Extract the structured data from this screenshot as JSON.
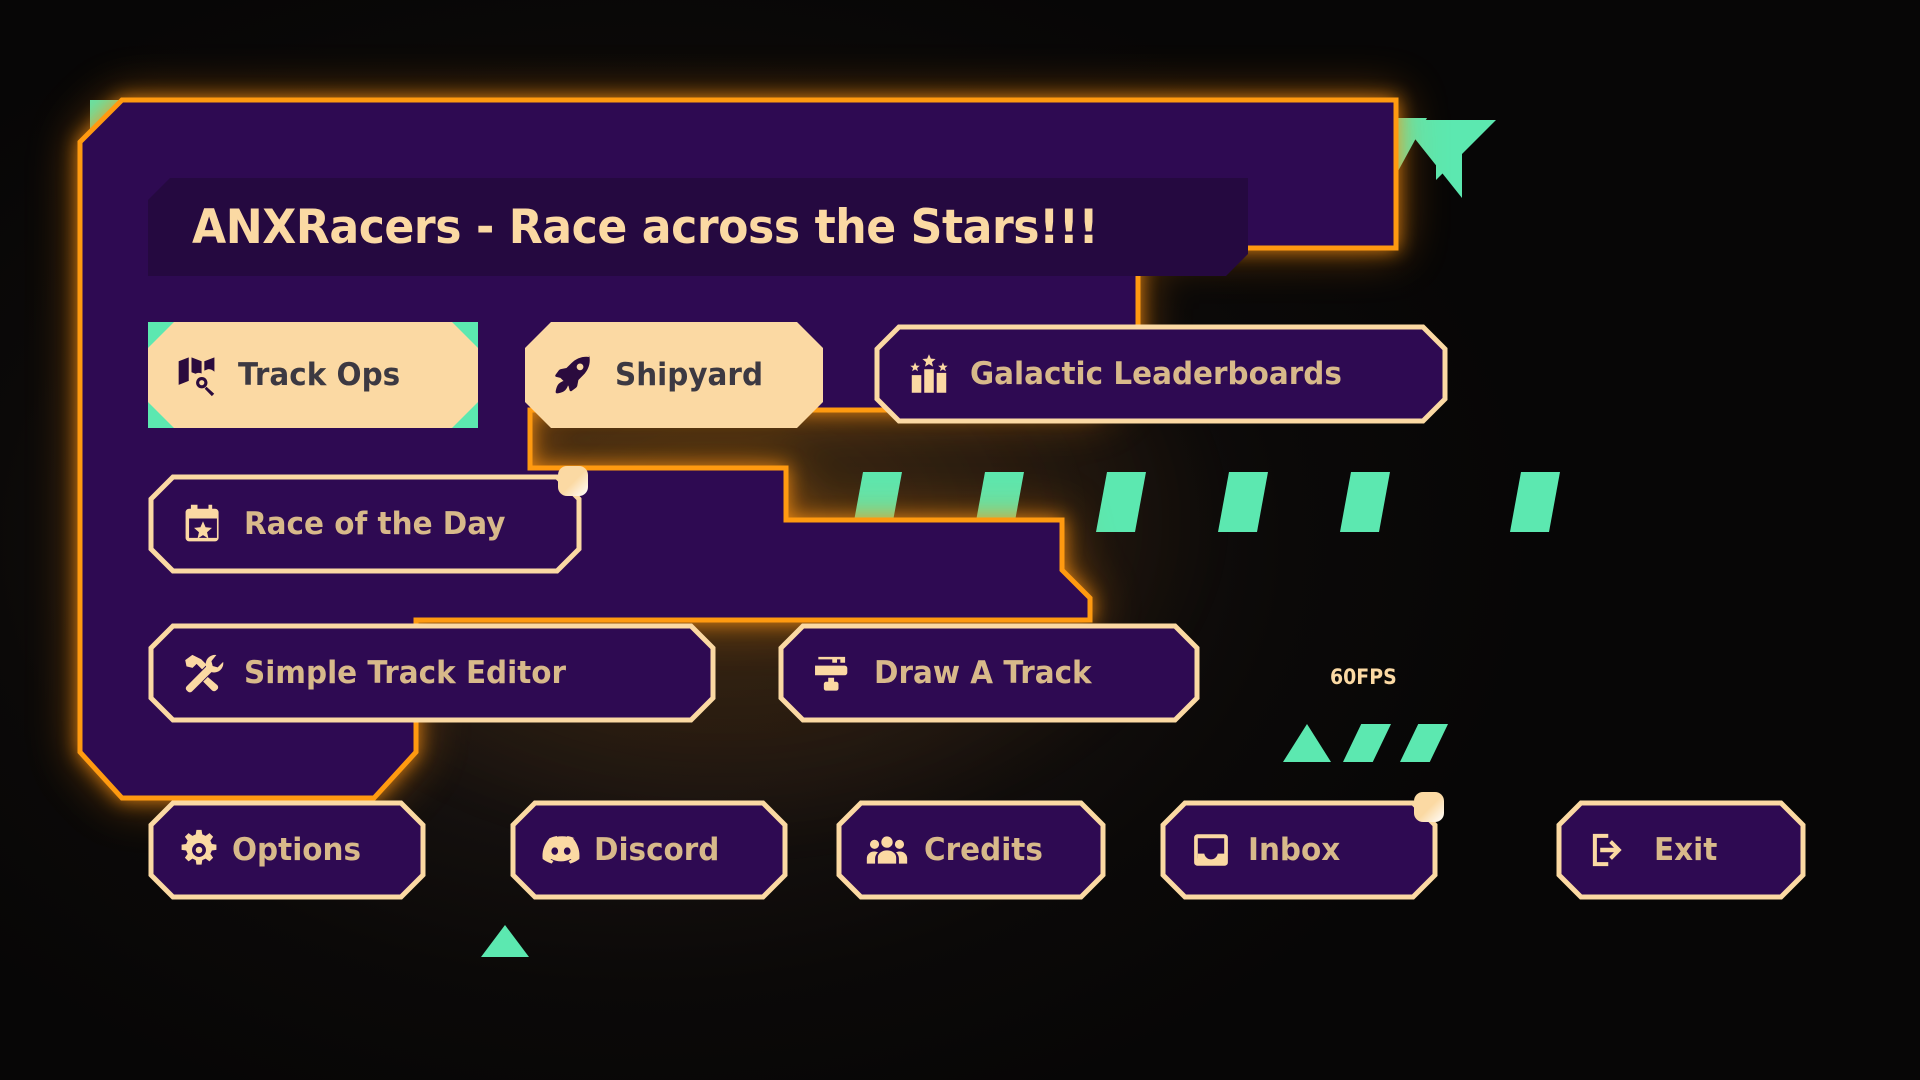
{
  "app": {
    "title": "ANXRacers - Race across the Stars!!!",
    "fps": "60FPS"
  },
  "theme": {
    "accent_orange": "#FF9A10",
    "panel_purple": "#2E0A52",
    "title_bar_purple": "#250940",
    "cream": "#FBD9A3",
    "label_cream": "#D8B98A",
    "dark_text": "#3C3942",
    "green": "#5CE8B0",
    "background": "#0B0908"
  },
  "buttons": {
    "track_ops": {
      "label": "Track Ops",
      "icon": "map-search-icon",
      "style": "filled",
      "badge": false
    },
    "shipyard": {
      "label": "Shipyard",
      "icon": "rocket-icon",
      "style": "filled",
      "badge": false
    },
    "leaderboards": {
      "label": "Galactic Leaderboards",
      "icon": "podium-stars-icon",
      "style": "outline",
      "badge": false
    },
    "race_of_day": {
      "label": "Race of the Day",
      "icon": "calendar-star-icon",
      "style": "outline",
      "badge": true
    },
    "track_editor": {
      "label": "Simple Track Editor",
      "icon": "tools-icon",
      "style": "outline",
      "badge": false
    },
    "draw_track": {
      "label": "Draw A Track",
      "icon": "paint-roller-icon",
      "style": "outline",
      "badge": false
    },
    "options": {
      "label": "Options",
      "icon": "gear-icon",
      "style": "outline",
      "badge": false
    },
    "discord": {
      "label": "Discord",
      "icon": "discord-icon",
      "style": "outline",
      "badge": false
    },
    "credits": {
      "label": "Credits",
      "icon": "people-icon",
      "style": "outline",
      "badge": false
    },
    "inbox": {
      "label": "Inbox",
      "icon": "inbox-icon",
      "style": "outline",
      "badge": true
    },
    "exit": {
      "label": "Exit",
      "icon": "exit-arrow-icon",
      "style": "outline",
      "badge": false
    }
  },
  "decorations": {
    "corner_triangles": "green-triangle-accent",
    "stripe_band": "green-diagonal-stripes",
    "chevrons": "green-chevron-accent"
  }
}
